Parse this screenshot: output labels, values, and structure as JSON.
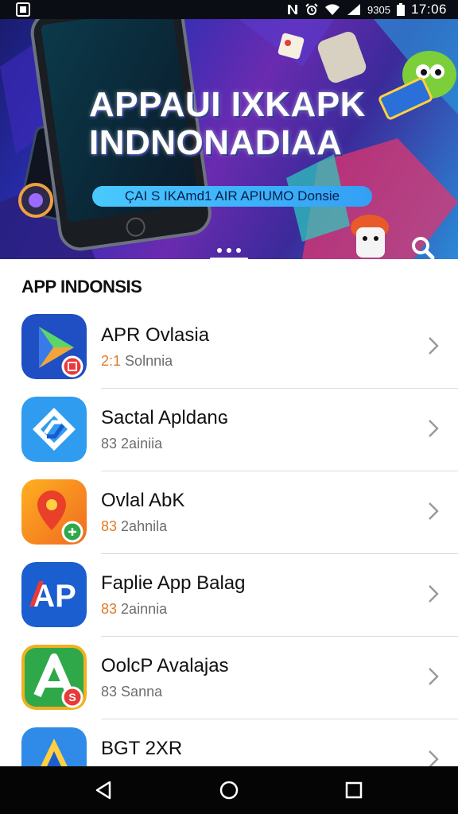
{
  "status_bar": {
    "battery_text": "9305",
    "time": "17:06",
    "icons": [
      "gallery-icon",
      "nfc-icon",
      "alarm-icon",
      "wifi-icon",
      "signal-icon",
      "battery-icon"
    ]
  },
  "banner": {
    "title_line1": "APPAUI IXKAPK",
    "title_line2": "INDNONADIAA",
    "subtitle": "ÇAI S IKAmd1 AIR APIUMO Donsie",
    "slide_count": 3,
    "active_slide": 1
  },
  "section": {
    "title": "APP INDONSIS"
  },
  "apps": [
    {
      "name": "APR Ovlasia",
      "sub_num": "2:1",
      "sub_text": "Solnnia",
      "icon": "play-triangle-icon",
      "num_color": "#e07a28"
    },
    {
      "name": "Sactal Apldanɢ",
      "sub_num": "83",
      "sub_text": "2ainiia",
      "icon": "arrows-diamond-icon",
      "num_color": "#6d6d6d"
    },
    {
      "name": "Ovlal AbK",
      "sub_num": "83",
      "sub_text": "2ahnila",
      "icon": "map-pin-icon",
      "num_color": "#e07a28"
    },
    {
      "name": "Faplie App Balag",
      "sub_num": "83",
      "sub_text": "2ainnia",
      "icon": "ap-letters-icon",
      "num_color": "#e07a28"
    },
    {
      "name": "OolcP Avalajas",
      "sub_num": "83",
      "sub_text": "Sanna",
      "icon": "a-letter-icon",
      "num_color": "#6d6d6d"
    },
    {
      "name": "BGT 2XR",
      "sub_num": "",
      "sub_text": "",
      "icon": "a-triangle-icon",
      "num_color": "#6d6d6d"
    }
  ],
  "nav": {
    "icons": [
      "back-icon",
      "home-icon",
      "recents-icon"
    ]
  }
}
